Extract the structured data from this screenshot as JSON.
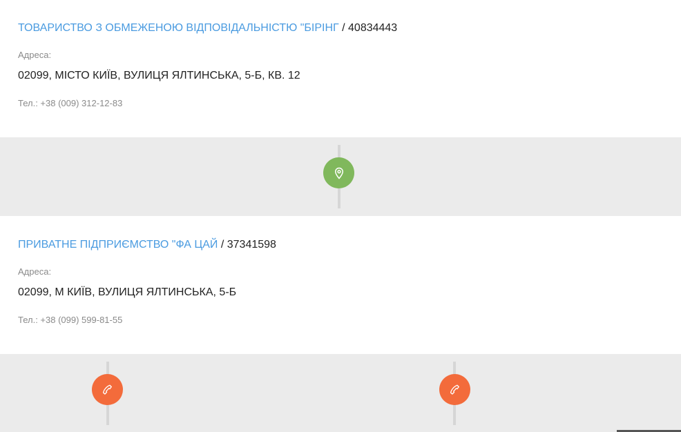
{
  "entries": [
    {
      "company_name": "ТОВАРИСТВО З ОБМЕЖЕНОЮ ВІДПОВІДАЛЬНІСТЮ \"БІРІНГ",
      "separator": " / ",
      "code": "40834443",
      "address_label": "Адреса:",
      "address": "02099, МІСТО КИЇВ, ВУЛИЦЯ ЯЛТИНСЬКА, 5-Б, КВ. 12",
      "phone": "Тел.: +38 (009) 312-12-83"
    },
    {
      "company_name": "ПРИВАТНЕ ПІДПРИЄМСТВО \"ФА ЦАЙ",
      "separator": " / ",
      "code": "37341598",
      "address_label": "Адреса:",
      "address": "02099, М КИЇВ, ВУЛИЦЯ ЯЛТИНСЬКА, 5-Б",
      "phone": "Тел.: +38 (099) 599-81-55"
    }
  ],
  "icons": {
    "map_pin": "map-pin-icon",
    "phone": "phone-icon"
  },
  "colors": {
    "link": "#4a9be0",
    "pin_circle": "#80b85c",
    "phone_circle": "#f36b3b",
    "band": "#ebebeb"
  }
}
